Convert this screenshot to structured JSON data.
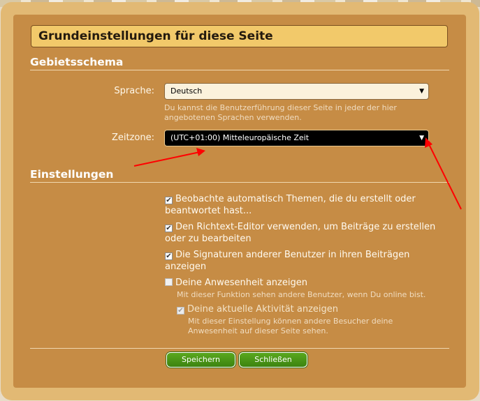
{
  "dialog": {
    "title": "Grundeinstellungen für diese Seite"
  },
  "locale_section": {
    "heading": "Gebietsschema",
    "language": {
      "label": "Sprache:",
      "value": "Deutsch",
      "hint": "Du kannst die Benutzerführung dieser Seite in jeder der hier angebotenen Sprachen verwenden."
    },
    "timezone": {
      "label": "Zeitzone:",
      "value": "(UTC+01:00) Mitteleuropäische Zeit"
    }
  },
  "settings_section": {
    "heading": "Einstellungen",
    "options": [
      {
        "label": "Beobachte automatisch Themen, die du erstellt oder beantwortet hast...",
        "checked": true
      },
      {
        "label": "Den Richtext-Editor verwenden, um Beiträge zu erstellen oder zu bearbeiten",
        "checked": true
      },
      {
        "label": "Die Signaturen anderer Benutzer in ihren Beiträgen anzeigen",
        "checked": true
      },
      {
        "label": "Deine Anwesenheit anzeigen",
        "checked": false,
        "hint": "Mit dieser Funktion sehen andere Benutzer, wenn Du online bist."
      },
      {
        "label": "Deine aktuelle Aktivität anzeigen",
        "checked": true,
        "disabled": true,
        "hint": "Mit dieser Einstellung können andere Besucher deine Anwesenheit auf dieser Seite sehen."
      }
    ]
  },
  "buttons": {
    "save": "Speichern",
    "close": "Schließen"
  },
  "colors": {
    "dialog_frame": "#e2b974",
    "panel": "#c68c45",
    "title_bar": "#f2c96a",
    "button": "#4a9616",
    "annotation_arrow": "#ff0000"
  },
  "icons": {
    "check": "✔",
    "dropdown": "▼"
  }
}
